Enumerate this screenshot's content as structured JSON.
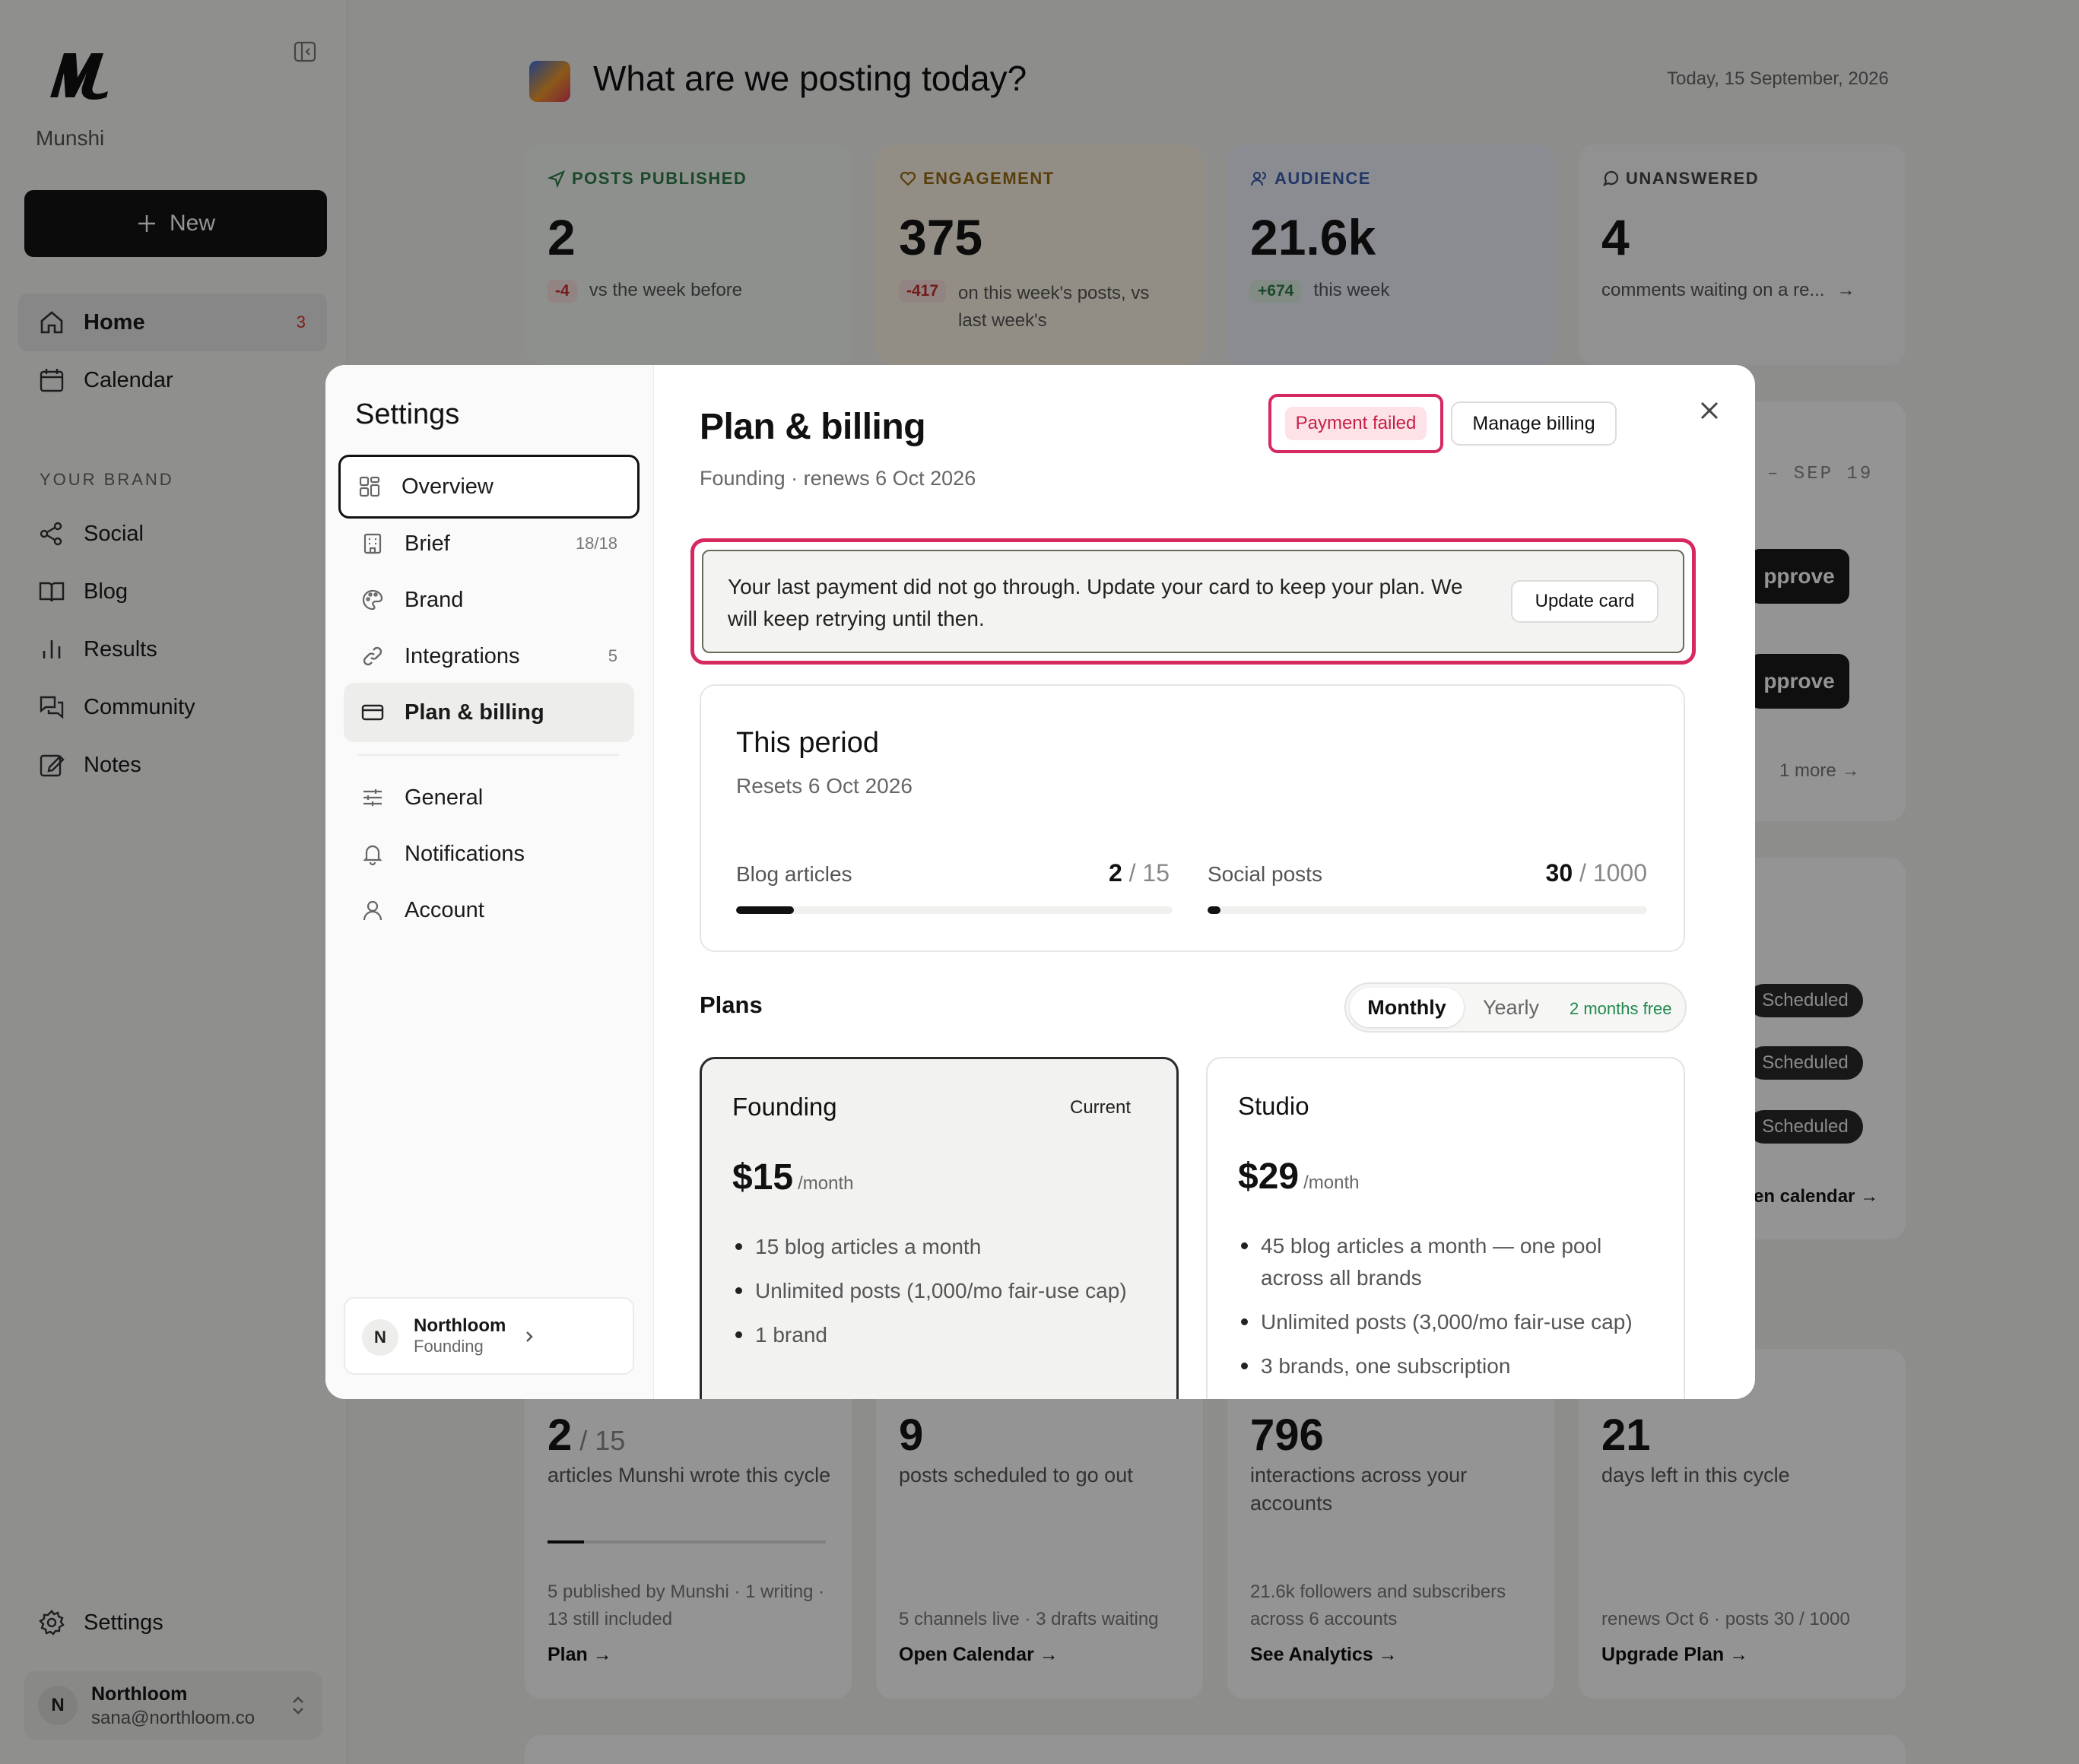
{
  "app": {
    "name": "Munshi",
    "new_label": "New"
  },
  "sidebar": {
    "nav": [
      {
        "label": "Home",
        "count": "3"
      },
      {
        "label": "Calendar"
      }
    ],
    "section_label": "YOUR BRAND",
    "brand_items": [
      {
        "label": "Social"
      },
      {
        "label": "Blog"
      },
      {
        "label": "Results"
      },
      {
        "label": "Community"
      },
      {
        "label": "Notes"
      }
    ],
    "settings_label": "Settings",
    "user": {
      "name": "Northloom",
      "email": "sana@northloom.co",
      "initial": "N"
    }
  },
  "page": {
    "title": "What are we posting today?",
    "date": "Today, 15 September, 2026",
    "stats": [
      {
        "label": "POSTS PUBLISHED",
        "value": "2",
        "delta": "-4",
        "note": "vs the week before",
        "color": "#2f7d49"
      },
      {
        "label": "ENGAGEMENT",
        "value": "375",
        "delta": "-417",
        "note": "on this week's posts, vs last week's",
        "color": "#9a6a12"
      },
      {
        "label": "AUDIENCE",
        "value": "21.6k",
        "delta": "+674",
        "note": "this week",
        "color": "#3b5fae"
      },
      {
        "label": "UNANSWERED",
        "value": "4",
        "note": "comments waiting on a re...",
        "color": "#444444"
      }
    ],
    "partial": {
      "range": "– SEP 19",
      "approve": "pprove",
      "more": "1 more",
      "scheduled": "Scheduled",
      "calendar_link": "en calendar →"
    },
    "bottom_cards": [
      {
        "value": "2",
        "value_suffix": "/ 15",
        "sub": "articles Munshi wrote this cycle",
        "foot": "5 published by Munshi · 1 writing · 13 still included",
        "link": "Plan →",
        "progress": 0.13
      },
      {
        "value": "9",
        "sub": "posts scheduled to go out",
        "foot": "5 channels live · 3 drafts waiting",
        "link": "Open Calendar →"
      },
      {
        "value": "796",
        "sub": "interactions across your accounts",
        "foot": "21.6k followers and subscribers across 6 accounts",
        "link": "See Analytics →"
      },
      {
        "value": "21",
        "sub": "days left in this cycle",
        "foot": "renews Oct 6 · posts 30 / 1000",
        "link": "Upgrade Plan →"
      }
    ]
  },
  "settings": {
    "title": "Settings",
    "menu": [
      {
        "label": "Overview"
      },
      {
        "label": "Brief",
        "count": "18/18"
      },
      {
        "label": "Brand"
      },
      {
        "label": "Integrations",
        "count": "5"
      },
      {
        "label": "Plan & billing"
      }
    ],
    "menu2": [
      {
        "label": "General"
      },
      {
        "label": "Notifications"
      },
      {
        "label": "Account"
      }
    ],
    "workspace": {
      "initial": "N",
      "name": "Northloom",
      "plan": "Founding"
    }
  },
  "billing": {
    "title": "Plan & billing",
    "subtitle": "Founding · renews 6 Oct 2026",
    "status_badge": "Payment failed",
    "manage_label": "Manage billing",
    "alert_text": "Your last payment did not go through. Update your card to keep your plan. We will keep retrying until then.",
    "update_card_label": "Update card",
    "period": {
      "title": "This period",
      "resets": "Resets 6 Oct 2026",
      "meters": [
        {
          "label": "Blog articles",
          "used": "2",
          "limit": "/ 15",
          "fraction": 0.133
        },
        {
          "label": "Social posts",
          "used": "30",
          "limit": "/ 1000",
          "fraction": 0.03
        }
      ]
    },
    "plans_heading": "Plans",
    "toggle": {
      "monthly": "Monthly",
      "yearly": "Yearly",
      "yearly_badge": "2 months free"
    },
    "plans": [
      {
        "name": "Founding",
        "badge": "Current",
        "price": "$15",
        "per": "/month",
        "features": [
          "15 blog articles a month",
          "Unlimited posts (1,000/mo fair-use cap)",
          "1 brand"
        ]
      },
      {
        "name": "Studio",
        "price": "$29",
        "per": "/month",
        "features": [
          "45 blog articles a month — one pool across all brands",
          "Unlimited posts (3,000/mo fair-use cap)",
          "3 brands, one subscription"
        ]
      }
    ]
  }
}
